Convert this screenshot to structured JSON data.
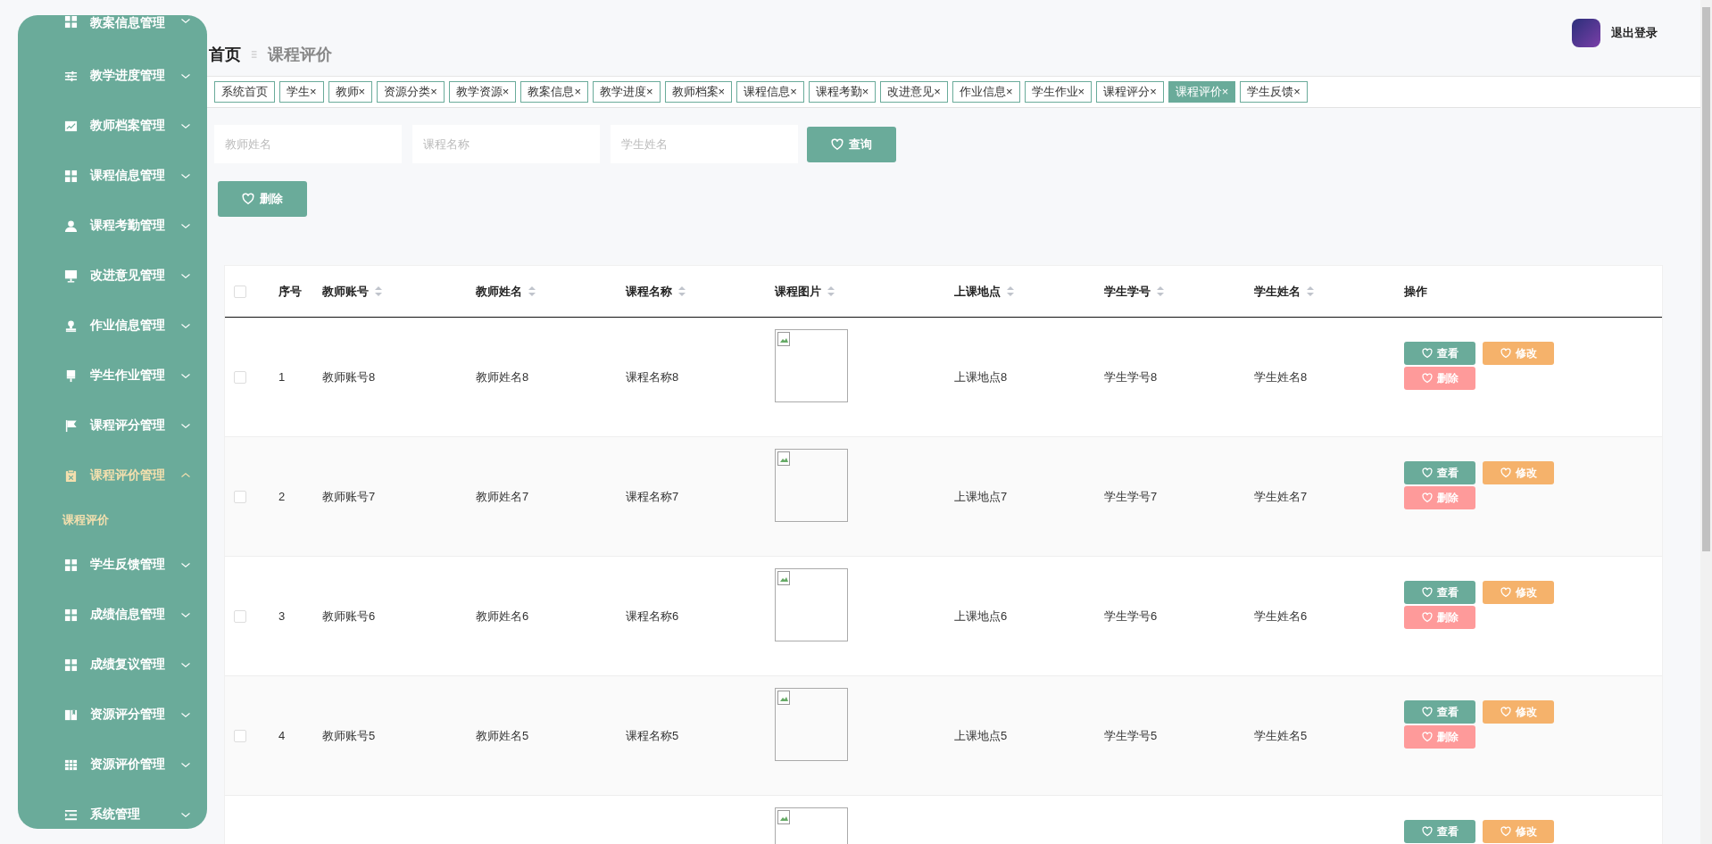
{
  "sidebar": {
    "items": [
      {
        "label": "教案信息管理",
        "kind": "grid",
        "expanded": false,
        "selected": false
      },
      {
        "label": "教学进度管理",
        "kind": "sliders",
        "expanded": false,
        "selected": false
      },
      {
        "label": "教师档案管理",
        "kind": "chart",
        "expanded": false,
        "selected": false
      },
      {
        "label": "课程信息管理",
        "kind": "grid",
        "expanded": false,
        "selected": false
      },
      {
        "label": "课程考勤管理",
        "kind": "user",
        "expanded": false,
        "selected": false
      },
      {
        "label": "改进意见管理",
        "kind": "monitor",
        "expanded": false,
        "selected": false
      },
      {
        "label": "作业信息管理",
        "kind": "stamp",
        "expanded": false,
        "selected": false
      },
      {
        "label": "学生作业管理",
        "kind": "brush",
        "expanded": false,
        "selected": false
      },
      {
        "label": "课程评分管理",
        "kind": "flag",
        "expanded": false,
        "selected": false
      },
      {
        "label": "课程评价管理",
        "kind": "clipboard",
        "expanded": true,
        "selected": true,
        "children": [
          {
            "label": "课程评价",
            "selected": true
          }
        ]
      },
      {
        "label": "学生反馈管理",
        "kind": "grid",
        "expanded": false,
        "selected": false
      },
      {
        "label": "成绩信息管理",
        "kind": "grid",
        "expanded": false,
        "selected": false
      },
      {
        "label": "成绩复议管理",
        "kind": "grid",
        "expanded": false,
        "selected": false
      },
      {
        "label": "资源评分管理",
        "kind": "book",
        "expanded": false,
        "selected": false
      },
      {
        "label": "资源评价管理",
        "kind": "table",
        "expanded": false,
        "selected": false
      },
      {
        "label": "系统管理",
        "kind": "list",
        "expanded": false,
        "selected": false
      }
    ]
  },
  "header": {
    "logout": "退出登录"
  },
  "breadcrumb": [
    "首页",
    "课程评价"
  ],
  "tabs": [
    {
      "label": "系统首页",
      "selected": false
    },
    {
      "label": "学生",
      "close": "×",
      "selected": false
    },
    {
      "label": "教师",
      "close": "×",
      "selected": false
    },
    {
      "label": "资源分类",
      "close": "×",
      "selected": false
    },
    {
      "label": "教学资源",
      "close": "×",
      "selected": false
    },
    {
      "label": "教案信息",
      "close": "×",
      "selected": false
    },
    {
      "label": "教学进度",
      "close": "×",
      "selected": false
    },
    {
      "label": "教师档案",
      "close": "×",
      "selected": false
    },
    {
      "label": "课程信息",
      "close": "×",
      "selected": false
    },
    {
      "label": "课程考勤",
      "close": "×",
      "selected": false
    },
    {
      "label": "改进意见",
      "close": "×",
      "selected": false
    },
    {
      "label": "作业信息",
      "close": "×",
      "selected": false
    },
    {
      "label": "学生作业",
      "close": "×",
      "selected": false
    },
    {
      "label": "课程评分",
      "close": "×",
      "selected": false
    },
    {
      "label": "课程评价",
      "close": "×",
      "selected": true
    },
    {
      "label": "学生反馈",
      "close": "×",
      "selected": false
    }
  ],
  "search": {
    "fields": [
      {
        "placeholder": "教师姓名"
      },
      {
        "placeholder": "课程名称"
      },
      {
        "placeholder": "学生姓名"
      }
    ],
    "button": "查询"
  },
  "toolbar": {
    "delete_button": "删除"
  },
  "table": {
    "select_all": {
      "checked": false
    },
    "columns": [
      {
        "label": "序号",
        "sortable": false
      },
      {
        "label": "教师账号",
        "sortable": true
      },
      {
        "label": "教师姓名",
        "sortable": true
      },
      {
        "label": "课程名称",
        "sortable": true
      },
      {
        "label": "课程图片",
        "sortable": true
      },
      {
        "label": "上课地点",
        "sortable": true
      },
      {
        "label": "学生学号",
        "sortable": true
      },
      {
        "label": "学生姓名",
        "sortable": true
      },
      {
        "label": "操作",
        "sortable": false
      }
    ],
    "rows": [
      {
        "checked": false,
        "cells": [
          "1",
          "教师账号8",
          "教师姓名8",
          "课程名称8",
          null,
          "上课地点8",
          "学生学号8",
          "学生姓名8"
        ],
        "actions": [
          {
            "label": "查看",
            "kind": "view"
          },
          {
            "label": "修改",
            "kind": "edit"
          },
          {
            "label": "删除",
            "kind": "delete"
          }
        ]
      },
      {
        "checked": false,
        "cells": [
          "2",
          "教师账号7",
          "教师姓名7",
          "课程名称7",
          null,
          "上课地点7",
          "学生学号7",
          "学生姓名7"
        ],
        "actions": [
          {
            "label": "查看",
            "kind": "view"
          },
          {
            "label": "修改",
            "kind": "edit"
          },
          {
            "label": "删除",
            "kind": "delete"
          }
        ]
      },
      {
        "checked": false,
        "cells": [
          "3",
          "教师账号6",
          "教师姓名6",
          "课程名称6",
          null,
          "上课地点6",
          "学生学号6",
          "学生姓名6"
        ],
        "actions": [
          {
            "label": "查看",
            "kind": "view"
          },
          {
            "label": "修改",
            "kind": "edit"
          },
          {
            "label": "删除",
            "kind": "delete"
          }
        ]
      },
      {
        "checked": false,
        "cells": [
          "4",
          "教师账号5",
          "教师姓名5",
          "课程名称5",
          null,
          "上课地点5",
          "学生学号5",
          "学生姓名5"
        ],
        "actions": [
          {
            "label": "查看",
            "kind": "view"
          },
          {
            "label": "修改",
            "kind": "edit"
          },
          {
            "label": "删除",
            "kind": "delete"
          }
        ]
      },
      {
        "actions": [
          {
            "label": "查看",
            "kind": "view"
          },
          {
            "label": "修改",
            "kind": "edit"
          }
        ]
      }
    ]
  }
}
